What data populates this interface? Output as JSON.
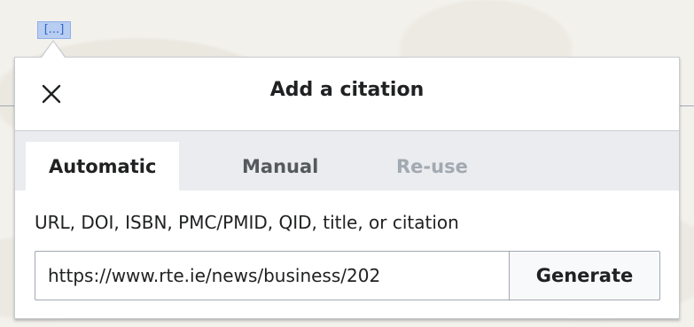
{
  "reference_marker": {
    "label": "[...]"
  },
  "dialog": {
    "title": "Add a citation",
    "close_icon": "close-icon",
    "tabs": [
      {
        "label": "Automatic",
        "state": "active"
      },
      {
        "label": "Manual",
        "state": "normal"
      },
      {
        "label": "Re-use",
        "state": "disabled"
      }
    ],
    "lookup": {
      "label": "URL, DOI, ISBN, PMC/PMID, QID, title, or citation",
      "value": "https://www.rte.ie/news/business/202",
      "button_label": "Generate"
    }
  },
  "colors": {
    "accent": "#3366cc",
    "marker_bg": "#b7cdf1",
    "border": "#c8ccd1",
    "tab_bar": "#eaecf0",
    "text": "#202122",
    "disabled_text": "#a2a9b1"
  }
}
